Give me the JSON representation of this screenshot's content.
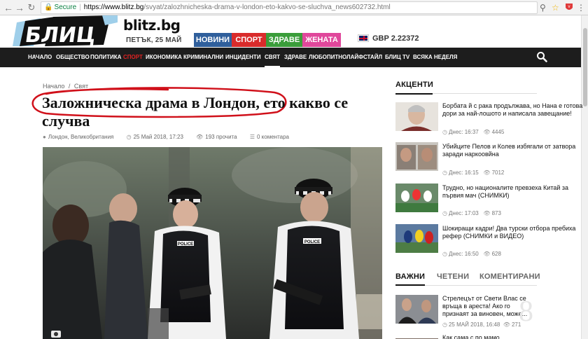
{
  "browser": {
    "secure_label": "Secure",
    "url_host": "https://www.blitz.bg",
    "url_path": "/svyat/zalozhnicheska-drama-v-london-eto-kakvo-se-sluchva_news602732.html"
  },
  "header": {
    "logo_text": "БЛИЦ",
    "logo_domain": "blitz.bg",
    "date": "ПЕТЪК, 25 МАЙ",
    "tabs": [
      {
        "label": "НОВИНИ",
        "color": "#2f5f9c"
      },
      {
        "label": "СПОРТ",
        "color": "#d92b2b"
      },
      {
        "label": "ЗДРАВЕ",
        "color": "#3a9d3a"
      },
      {
        "label": "ЖЕНАТА",
        "color": "#e0479b"
      }
    ],
    "currency": "GBP 2.22372"
  },
  "nav": {
    "items": [
      "НАЧАЛО",
      "ОБЩЕСТВО",
      "ПОЛИТИКА",
      "СПОРТ",
      "ИКОНОМИКА",
      "КРИМИНАЛНИ",
      "ИНЦИДЕНТИ",
      "СВЯТ",
      "ЗДРАВЕ",
      "ЛЮБОПИТНО",
      "ЛАЙФСТАЙЛ",
      "БЛИЦ TV",
      "ВСЯКА НЕДЕЛЯ"
    ],
    "active": "СВЯТ"
  },
  "article": {
    "breadcrumb_home": "Начало",
    "breadcrumb_sep": "/",
    "breadcrumb_section": "Свят",
    "title": "Заложническа драма в Лондон, ето какво се случва",
    "location": "Лондон, Великобритания",
    "datetime": "25 Май 2018, 17:23",
    "views": "193 прочита",
    "comments": "0 коментара",
    "police_label": "POLICE"
  },
  "sidebar": {
    "accents_title": "АКЦЕНТИ",
    "accents": [
      {
        "text": "Борбата й с рака продължава, но Нана е готова дори за най-лошото и написала завещание!",
        "time": "Днес: 16:37",
        "views": "4445"
      },
      {
        "text": "Убийците Пелов и Колев избягали от затвора заради наркоовйна",
        "time": "Днес: 16:15",
        "views": "7012"
      },
      {
        "text": "Трудно, но националите превзеха Китай за първия мач (СНИМКИ)",
        "time": "Днес: 17:03",
        "views": "873"
      },
      {
        "text": "Шокиращи кадри! Два турски отбора пребиха рефер (СНИМКИ и ВИДЕО)",
        "time": "Днес: 16:50",
        "views": "628"
      }
    ],
    "tabs": [
      "ВАЖНИ",
      "ЧЕТЕНИ",
      "КОМЕНТИРАНИ"
    ],
    "important": [
      {
        "text": "Стрелецът от Свети Влас се връща в ареста! Ако го признаят за виновен, може...",
        "time": "25 МАЙ 2018, 16:48",
        "views": "271",
        "badge": "8"
      }
    ],
    "partial_text": "Как сама с по мамо..."
  }
}
